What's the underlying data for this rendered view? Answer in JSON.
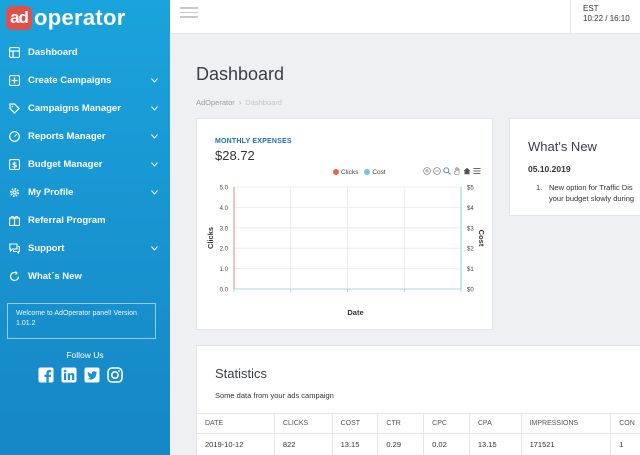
{
  "app": {
    "logo_badge": "ad",
    "logo_text": "operator"
  },
  "sidebar": {
    "items": [
      {
        "label": "Dashboard",
        "icon": "dashboard-icon",
        "expandable": false
      },
      {
        "label": "Create Campaigns",
        "icon": "plus-square-icon",
        "expandable": true
      },
      {
        "label": "Campaigns Manager",
        "icon": "tag-icon",
        "expandable": true
      },
      {
        "label": "Reports Manager",
        "icon": "gauge-icon",
        "expandable": true
      },
      {
        "label": "Budget Manager",
        "icon": "dollar-icon",
        "expandable": true
      },
      {
        "label": "My Profile",
        "icon": "gear-icon",
        "expandable": true
      },
      {
        "label": "Referral Program",
        "icon": "referral-icon",
        "expandable": false
      },
      {
        "label": "Support",
        "icon": "chat-icon",
        "expandable": true
      },
      {
        "label": "What´s New",
        "icon": "refresh-icon",
        "expandable": false
      }
    ],
    "welcome": "Welcome to AdOperator panel! Version 1.01.2",
    "follow_us": "Follow Us",
    "social": [
      "facebook-icon",
      "linkedin-icon",
      "twitter-icon",
      "instagram-icon"
    ]
  },
  "topbar": {
    "timezone": "EST",
    "time": "10:22 / 16:10"
  },
  "page": {
    "title": "Dashboard",
    "breadcrumb": [
      "AdOperator",
      "Dashboard"
    ]
  },
  "expenses": {
    "label": "MONTHLY EXPENSES",
    "value": "$28.72"
  },
  "chart_data": {
    "type": "line",
    "series": [
      {
        "name": "Clicks",
        "color": "#e8674a",
        "values": []
      },
      {
        "name": "Cost",
        "color": "#74c3e6",
        "values": []
      }
    ],
    "xlabel": "Date",
    "ylabel": "Clicks",
    "y2label": "Cost",
    "ylim": [
      0,
      5
    ],
    "y2lim": [
      0,
      5
    ],
    "yticks": [
      "5.0",
      "4.0",
      "3.0",
      "2.0",
      "1.0",
      "0.0"
    ],
    "y2ticks": [
      "$5",
      "$4",
      "$3",
      "$2",
      "$1",
      "$0"
    ],
    "grid": true,
    "legend": "top-right"
  },
  "news": {
    "title": "What's New",
    "date": "05.10.2019",
    "item_num": "1.",
    "item_line1": "New option for Traffic Dis",
    "item_line2": "your budget slowly during"
  },
  "stats": {
    "title": "Statistics",
    "subtitle": "Some data from your ads campaign",
    "columns": [
      "DATE",
      "CLICKS",
      "COST",
      "CTR",
      "CPC",
      "CPA",
      "IMPRESSIONS",
      "CON"
    ],
    "rows": [
      [
        "2019-10-12",
        "822",
        "13.15",
        "0.29",
        "0.02",
        "13.15",
        "171521",
        "1"
      ]
    ]
  },
  "colors": {
    "sidebar": "#1a9ad6",
    "accent": "#1e6fb0",
    "clicks": "#e8674a",
    "cost": "#74c3e6"
  }
}
